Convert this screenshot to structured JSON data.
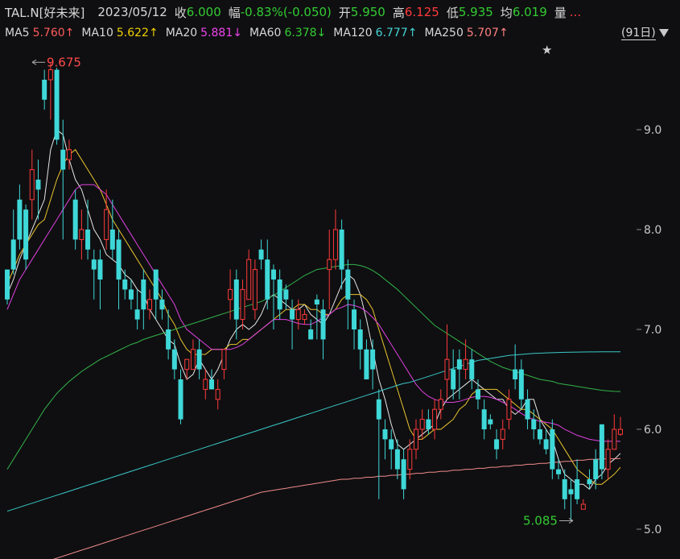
{
  "header": {
    "symbol": "TAL.N[好未来]",
    "date": "2023/05/12",
    "close_label": "收",
    "close_value": "6.000",
    "change_label": "幅",
    "change_value": "-0.83%(-0.050)",
    "open_label": "开",
    "open_value": "5.950",
    "high_label": "高",
    "high_value": "6.125",
    "low_label": "低",
    "low_value": "5.935",
    "avg_label": "均",
    "avg_value": "6.019",
    "volume_label": "量",
    "volume_value": "..."
  },
  "ma_row": {
    "ma5_label": "MA5",
    "ma5_value": "5.760↑",
    "ma10_label": "MA10",
    "ma10_value": "5.622↑",
    "ma20_label": "MA20",
    "ma20_value": "5.881↓",
    "ma60_label": "MA60",
    "ma60_value": "6.378↓",
    "ma120_label": "MA120",
    "ma120_value": "6.777↑",
    "ma250_label": "MA250",
    "ma250_value": "5.707↑",
    "period": "(91日)"
  },
  "colors": {
    "up": "#ff3a3a",
    "down": "#3fd8d8",
    "ma5": "#e6e6e6",
    "ma10": "#e8c32e",
    "ma20": "#e040e0",
    "ma60": "#33b34a",
    "ma120": "#3ac8c8",
    "ma250": "#f08a8a"
  },
  "chart_data": {
    "type": "candlestick",
    "ylim": [
      4.75,
      10.3
    ],
    "y_ticks": [
      "9.0",
      "8.0",
      "7.0",
      "6.0",
      "5.0"
    ],
    "annotations": {
      "high": "9.675",
      "low": "5.085",
      "star": "★"
    },
    "candles": [
      [
        7.6,
        7.3,
        7.5,
        7.25
      ],
      [
        7.9,
        7.6,
        8.2,
        7.55
      ],
      [
        8.3,
        7.9,
        8.45,
        7.8
      ],
      [
        8.2,
        7.7,
        8.25,
        7.6
      ],
      [
        8.3,
        8.6,
        8.8,
        8.1
      ],
      [
        8.5,
        8.4,
        8.7,
        8.1
      ],
      [
        9.5,
        9.3,
        9.6,
        9.2
      ],
      [
        9.5,
        9.6,
        9.675,
        9.1
      ],
      [
        9.6,
        8.9,
        9.62,
        8.85
      ],
      [
        8.8,
        8.6,
        9.1,
        7.9
      ],
      [
        8.7,
        8.8,
        8.9,
        8.6
      ],
      [
        8.3,
        7.9,
        8.4,
        7.8
      ],
      [
        7.9,
        8.0,
        8.2,
        7.7
      ],
      [
        8.0,
        7.8,
        8.3,
        7.7
      ],
      [
        7.7,
        7.6,
        7.8,
        7.3
      ],
      [
        7.7,
        7.5,
        7.8,
        7.2
      ],
      [
        7.9,
        8.2,
        8.4,
        7.8
      ],
      [
        8.0,
        7.8,
        8.3,
        7.7
      ],
      [
        7.9,
        7.5,
        8.0,
        7.2
      ],
      [
        7.5,
        7.4,
        7.6,
        7.3
      ],
      [
        7.4,
        7.3,
        7.5,
        7.2
      ],
      [
        7.2,
        7.1,
        7.4,
        7.0
      ],
      [
        7.5,
        7.2,
        7.6,
        7.0
      ],
      [
        7.2,
        7.3,
        7.4,
        7.1
      ],
      [
        7.6,
        7.3,
        7.6,
        7.1
      ],
      [
        7.3,
        7.2,
        7.4,
        7.1
      ],
      [
        7.0,
        6.8,
        7.2,
        6.7
      ],
      [
        6.8,
        6.6,
        6.9,
        6.5
      ],
      [
        6.5,
        6.1,
        6.6,
        6.05
      ],
      [
        6.6,
        6.7,
        6.7,
        6.5
      ],
      [
        6.6,
        6.8,
        6.9,
        6.6
      ],
      [
        6.8,
        6.6,
        6.9,
        6.5
      ],
      [
        6.4,
        6.5,
        6.6,
        6.3
      ],
      [
        6.5,
        6.4,
        6.6,
        6.4
      ],
      [
        6.3,
        6.4,
        6.5,
        6.2
      ],
      [
        6.6,
        6.8,
        6.8,
        6.5
      ],
      [
        7.3,
        7.4,
        7.6,
        7.1
      ],
      [
        7.5,
        7.1,
        7.6,
        6.9
      ],
      [
        7.1,
        7.4,
        7.5,
        7.0
      ],
      [
        7.3,
        7.7,
        7.8,
        7.3
      ],
      [
        7.2,
        7.6,
        7.7,
        7.1
      ],
      [
        7.8,
        7.7,
        7.9,
        7.6
      ],
      [
        7.7,
        7.3,
        7.9,
        7.2
      ],
      [
        7.6,
        7.5,
        7.65,
        7.0
      ],
      [
        7.5,
        7.2,
        7.6,
        7.1
      ],
      [
        7.4,
        7.3,
        7.45,
        7.2
      ],
      [
        7.2,
        7.1,
        7.3,
        6.8
      ],
      [
        7.1,
        7.2,
        7.3,
        7.0
      ],
      [
        7.1,
        7.15,
        7.2,
        7.05
      ],
      [
        7.0,
        6.9,
        7.1,
        6.9
      ],
      [
        7.3,
        7.25,
        7.35,
        6.9
      ],
      [
        7.2,
        6.9,
        7.3,
        6.7
      ],
      [
        7.6,
        7.7,
        8.0,
        7.2
      ],
      [
        7.7,
        8.0,
        8.2,
        7.6
      ],
      [
        8.0,
        7.6,
        8.1,
        7.4
      ],
      [
        7.6,
        7.3,
        7.7,
        7.0
      ],
      [
        7.2,
        7.0,
        7.3,
        6.8
      ],
      [
        7.0,
        6.8,
        7.1,
        6.6
      ],
      [
        6.8,
        6.5,
        6.9,
        6.5
      ],
      [
        6.8,
        6.6,
        6.9,
        6.4
      ],
      [
        6.3,
        6.1,
        6.4,
        5.3
      ],
      [
        6.0,
        5.9,
        6.1,
        5.7
      ],
      [
        5.9,
        5.8,
        6.0,
        5.6
      ],
      [
        5.8,
        5.6,
        5.9,
        5.5
      ],
      [
        5.7,
        5.4,
        5.8,
        5.3
      ],
      [
        5.6,
        5.8,
        5.9,
        5.5
      ],
      [
        5.8,
        6.0,
        6.1,
        5.7
      ],
      [
        6.0,
        6.1,
        6.2,
        5.9
      ],
      [
        6.1,
        6.0,
        6.2,
        5.95
      ],
      [
        6.0,
        6.2,
        6.3,
        5.9
      ],
      [
        6.2,
        6.3,
        6.4,
        6.1
      ],
      [
        6.5,
        6.7,
        7.05,
        6.3
      ],
      [
        6.6,
        6.4,
        6.8,
        6.3
      ],
      [
        6.7,
        6.6,
        6.8,
        6.3
      ],
      [
        6.6,
        6.7,
        6.9,
        6.5
      ],
      [
        6.7,
        6.5,
        6.8,
        6.4
      ],
      [
        6.4,
        6.3,
        6.5,
        6.2
      ],
      [
        6.2,
        6.0,
        6.3,
        5.9
      ],
      [
        6.1,
        6.05,
        6.15,
        6.0
      ],
      [
        5.9,
        5.8,
        6.0,
        5.7
      ],
      [
        5.9,
        6.0,
        6.1,
        5.8
      ],
      [
        6.1,
        6.3,
        6.4,
        6.0
      ],
      [
        6.6,
        6.5,
        6.85,
        6.4
      ],
      [
        6.6,
        6.3,
        6.7,
        6.2
      ],
      [
        6.3,
        6.1,
        6.4,
        6.0
      ],
      [
        6.1,
        6.0,
        6.2,
        5.9
      ],
      [
        6.0,
        5.9,
        6.1,
        5.85
      ],
      [
        5.9,
        5.8,
        6.0,
        5.75
      ],
      [
        6.0,
        5.6,
        6.1,
        5.5
      ],
      [
        5.6,
        5.55,
        5.7,
        5.5
      ],
      [
        5.5,
        5.3,
        5.6,
        5.2
      ],
      [
        5.4,
        5.35,
        5.5,
        5.085
      ],
      [
        5.5,
        5.3,
        5.7,
        5.25
      ],
      [
        5.2,
        5.25,
        5.3,
        5.2
      ],
      [
        5.5,
        5.45,
        5.6,
        5.4
      ],
      [
        5.7,
        5.5,
        5.8,
        5.4
      ],
      [
        6.05,
        5.6,
        6.05,
        5.5
      ],
      [
        5.6,
        5.8,
        5.9,
        5.5
      ],
      [
        5.8,
        6.0,
        6.15,
        5.8
      ],
      [
        5.95,
        6.0,
        6.125,
        5.935
      ]
    ],
    "series": [
      {
        "name": "MA5",
        "values": [
          7.35,
          7.5,
          7.7,
          7.85,
          8.0,
          8.15,
          8.3,
          8.8,
          9.0,
          8.95,
          8.7,
          8.5,
          8.4,
          8.2,
          8.0,
          7.9,
          7.75,
          7.7,
          7.65,
          7.55,
          7.5,
          7.4,
          7.35,
          7.2,
          7.1,
          7.0,
          6.9,
          6.85,
          6.65,
          6.5,
          6.55,
          6.7,
          6.6,
          6.5,
          6.6,
          6.75,
          6.9,
          7.0,
          7.05,
          7.0,
          7.05,
          7.15,
          7.3,
          7.35,
          7.3,
          7.25,
          7.2,
          7.2,
          7.25,
          7.15,
          7.1,
          7.05,
          7.15,
          7.3,
          7.45,
          7.55,
          7.5,
          7.35,
          7.1,
          6.8,
          6.5,
          6.3,
          6.05,
          5.85,
          5.8,
          5.85,
          5.9,
          5.95,
          6.0,
          6.05,
          6.2,
          6.3,
          6.35,
          6.4,
          6.45,
          6.5,
          6.45,
          6.4,
          6.35,
          6.3,
          6.3,
          6.2,
          6.15,
          6.2,
          6.3,
          6.3,
          6.1,
          6.0,
          5.9,
          5.7,
          5.55,
          5.5,
          5.45,
          5.45,
          5.4,
          5.5,
          5.55,
          5.65,
          5.7,
          5.76
        ]
      },
      {
        "name": "MA10",
        "values": [
          7.45,
          7.6,
          7.75,
          7.85,
          7.95,
          8.05,
          8.1,
          8.3,
          8.5,
          8.65,
          8.75,
          8.8,
          8.7,
          8.6,
          8.5,
          8.4,
          8.25,
          8.1,
          8.0,
          7.9,
          7.8,
          7.7,
          7.6,
          7.5,
          7.4,
          7.3,
          7.15,
          7.05,
          6.9,
          6.8,
          6.75,
          6.75,
          6.75,
          6.8,
          6.8,
          6.8,
          6.85,
          6.85,
          6.9,
          6.9,
          6.95,
          7.0,
          7.05,
          7.1,
          7.15,
          7.2,
          7.2,
          7.25,
          7.25,
          7.2,
          7.2,
          7.15,
          7.15,
          7.2,
          7.3,
          7.35,
          7.35,
          7.35,
          7.3,
          7.2,
          7.0,
          6.8,
          6.6,
          6.4,
          6.2,
          6.0,
          5.9,
          5.9,
          5.95,
          6.0,
          6.0,
          6.05,
          6.1,
          6.2,
          6.25,
          6.35,
          6.4,
          6.4,
          6.4,
          6.4,
          6.35,
          6.3,
          6.25,
          6.2,
          6.2,
          6.15,
          6.1,
          6.05,
          6.0,
          5.9,
          5.8,
          5.7,
          5.6,
          5.55,
          5.5,
          5.45,
          5.45,
          5.5,
          5.55,
          5.62
        ]
      },
      {
        "name": "MA20",
        "values": [
          7.2,
          7.35,
          7.5,
          7.6,
          7.7,
          7.8,
          7.9,
          8.0,
          8.1,
          8.2,
          8.3,
          8.4,
          8.45,
          8.45,
          8.45,
          8.4,
          8.35,
          8.25,
          8.15,
          8.05,
          7.95,
          7.85,
          7.75,
          7.65,
          7.55,
          7.45,
          7.35,
          7.25,
          7.1,
          7.0,
          6.95,
          6.9,
          6.85,
          6.8,
          6.8,
          6.8,
          6.8,
          6.82,
          6.85,
          6.9,
          6.95,
          7.0,
          7.05,
          7.1,
          7.1,
          7.1,
          7.08,
          7.06,
          7.05,
          7.05,
          7.08,
          7.12,
          7.15,
          7.2,
          7.22,
          7.25,
          7.24,
          7.22,
          7.18,
          7.12,
          7.05,
          6.95,
          6.85,
          6.75,
          6.65,
          6.55,
          6.45,
          6.38,
          6.33,
          6.3,
          6.28,
          6.27,
          6.27,
          6.28,
          6.3,
          6.32,
          6.33,
          6.33,
          6.32,
          6.3,
          6.27,
          6.24,
          6.2,
          6.16,
          6.12,
          6.1,
          6.08,
          6.07,
          6.06,
          6.04,
          6.0,
          5.97,
          5.94,
          5.92,
          5.9,
          5.89,
          5.88,
          5.88,
          5.88,
          5.88
        ]
      },
      {
        "name": "MA60",
        "values": [
          5.6,
          5.7,
          5.8,
          5.9,
          6.0,
          6.1,
          6.2,
          6.28,
          6.36,
          6.42,
          6.48,
          6.53,
          6.58,
          6.62,
          6.66,
          6.7,
          6.73,
          6.76,
          6.79,
          6.82,
          6.85,
          6.87,
          6.9,
          6.92,
          6.94,
          6.96,
          6.98,
          7.0,
          7.02,
          7.04,
          7.06,
          7.08,
          7.1,
          7.12,
          7.14,
          7.16,
          7.18,
          7.2,
          7.22,
          7.24,
          7.26,
          7.28,
          7.31,
          7.34,
          7.38,
          7.42,
          7.46,
          7.5,
          7.54,
          7.57,
          7.6,
          7.61,
          7.62,
          7.63,
          7.64,
          7.65,
          7.65,
          7.64,
          7.62,
          7.59,
          7.55,
          7.5,
          7.45,
          7.4,
          7.34,
          7.28,
          7.22,
          7.16,
          7.1,
          7.04,
          7.0,
          6.96,
          6.92,
          6.88,
          6.84,
          6.8,
          6.76,
          6.72,
          6.68,
          6.65,
          6.62,
          6.6,
          6.58,
          6.56,
          6.54,
          6.52,
          6.5,
          6.49,
          6.48,
          6.46,
          6.45,
          6.44,
          6.43,
          6.42,
          6.41,
          6.4,
          6.39,
          6.385,
          6.38,
          6.378
        ]
      },
      {
        "name": "MA120",
        "values": [
          5.18,
          5.2,
          5.22,
          5.24,
          5.26,
          5.28,
          5.3,
          5.32,
          5.34,
          5.36,
          5.38,
          5.4,
          5.42,
          5.44,
          5.46,
          5.48,
          5.5,
          5.52,
          5.54,
          5.56,
          5.58,
          5.6,
          5.62,
          5.64,
          5.66,
          5.68,
          5.7,
          5.72,
          5.74,
          5.76,
          5.78,
          5.8,
          5.82,
          5.84,
          5.86,
          5.88,
          5.9,
          5.92,
          5.94,
          5.96,
          5.98,
          6.0,
          6.02,
          6.04,
          6.06,
          6.08,
          6.1,
          6.12,
          6.14,
          6.16,
          6.18,
          6.2,
          6.22,
          6.24,
          6.26,
          6.28,
          6.3,
          6.32,
          6.34,
          6.36,
          6.38,
          6.4,
          6.42,
          6.44,
          6.46,
          6.47,
          6.49,
          6.51,
          6.53,
          6.55,
          6.57,
          6.59,
          6.61,
          6.63,
          6.65,
          6.67,
          6.69,
          6.7,
          6.71,
          6.72,
          6.73,
          6.74,
          6.745,
          6.75,
          6.755,
          6.76,
          6.762,
          6.765,
          6.767,
          6.769,
          6.771,
          6.772,
          6.773,
          6.774,
          6.775,
          6.775,
          6.776,
          6.776,
          6.777,
          6.777
        ]
      },
      {
        "name": "MA250",
        "values": [
          4.55,
          4.57,
          4.59,
          4.61,
          4.63,
          4.65,
          4.67,
          4.69,
          4.71,
          4.73,
          4.75,
          4.77,
          4.79,
          4.81,
          4.83,
          4.85,
          4.87,
          4.89,
          4.91,
          4.93,
          4.95,
          4.97,
          4.99,
          5.01,
          5.03,
          5.05,
          5.07,
          5.09,
          5.11,
          5.13,
          5.15,
          5.17,
          5.19,
          5.21,
          5.23,
          5.25,
          5.27,
          5.29,
          5.31,
          5.33,
          5.35,
          5.37,
          5.38,
          5.39,
          5.4,
          5.41,
          5.42,
          5.43,
          5.44,
          5.45,
          5.46,
          5.47,
          5.48,
          5.49,
          5.5,
          5.5,
          5.51,
          5.51,
          5.52,
          5.52,
          5.53,
          5.53,
          5.54,
          5.54,
          5.55,
          5.55,
          5.56,
          5.56,
          5.57,
          5.57,
          5.58,
          5.58,
          5.59,
          5.59,
          5.6,
          5.6,
          5.61,
          5.61,
          5.62,
          5.62,
          5.63,
          5.63,
          5.64,
          5.64,
          5.65,
          5.65,
          5.66,
          5.66,
          5.67,
          5.67,
          5.68,
          5.68,
          5.69,
          5.69,
          5.7,
          5.7,
          5.703,
          5.705,
          5.706,
          5.707
        ]
      }
    ]
  }
}
